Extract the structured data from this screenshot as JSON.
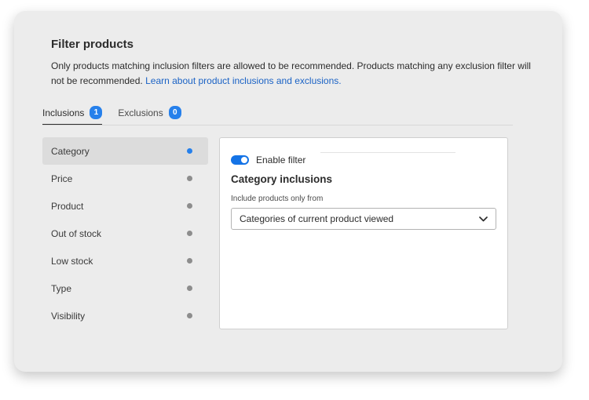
{
  "header": {
    "title": "Filter products",
    "description": "Only products matching inclusion filters are allowed to be recommended. Products matching any exclusion filter will not be recommended.",
    "link_text": "Learn about product inclusions and exclusions."
  },
  "tabs": [
    {
      "label": "Inclusions",
      "count": "1",
      "active": true
    },
    {
      "label": "Exclusions",
      "count": "0",
      "active": false
    }
  ],
  "sidebar": {
    "items": [
      {
        "label": "Category",
        "active": true
      },
      {
        "label": "Price",
        "active": false
      },
      {
        "label": "Product",
        "active": false
      },
      {
        "label": "Out of stock",
        "active": false
      },
      {
        "label": "Low stock",
        "active": false
      },
      {
        "label": "Type",
        "active": false
      },
      {
        "label": "Visibility",
        "active": false
      }
    ]
  },
  "panel": {
    "toggle_label": "Enable filter",
    "toggle_on": true,
    "title": "Category inclusions",
    "field_label": "Include products only from",
    "select_value": "Categories of current product viewed"
  },
  "colors": {
    "accent": "#1473e6",
    "badge": "#2680eb",
    "link": "#1a62c5",
    "card_bg": "#ececec"
  },
  "icons": {
    "active_indicator": "dot-icon",
    "select_arrow": "chevron-down-icon"
  }
}
